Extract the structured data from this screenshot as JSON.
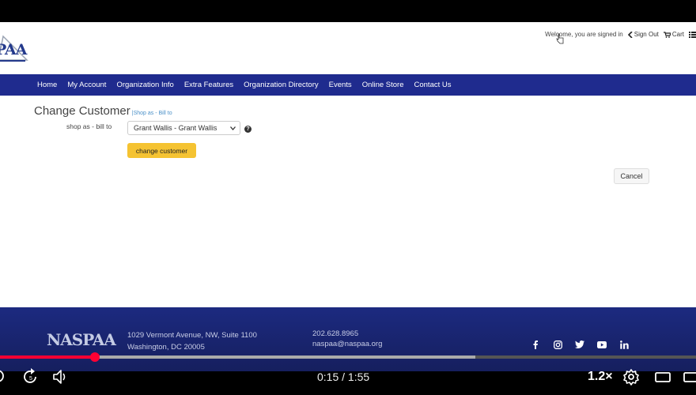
{
  "header": {
    "logo_text": "PAA",
    "welcome": "Welcome, you are signed in",
    "sign_out": "Sign Out",
    "cart": "Cart"
  },
  "nav": {
    "items": [
      "Home",
      "My Account",
      "Organization Info",
      "Extra Features",
      "Organization Directory",
      "Events",
      "Online Store",
      "Contact Us"
    ]
  },
  "main": {
    "title": "Change Customer",
    "subtitle": "Shop as - Bill to",
    "field_label": "shop as - bill to",
    "select_value": "Grant Wallis - Grant Wallis",
    "help_glyph": "?",
    "change_button": "change customer",
    "cancel_button": "Cancel"
  },
  "footer": {
    "logo": "NASPAA",
    "address_line1": "1029 Vermont Avenue, NW, Suite 1100",
    "address_line2": "Washington, DC 20005",
    "phone": "202.628.8965",
    "email": "naspaa@naspaa.org",
    "social": [
      "facebook-icon",
      "instagram-icon",
      "twitter-icon",
      "youtube-icon",
      "linkedin-icon"
    ]
  },
  "player": {
    "time": "0:15 / 1:55",
    "speed": "1.2×",
    "played_fraction": 0.136,
    "buffered_fraction": 0.683,
    "accent": "#ff0033"
  }
}
